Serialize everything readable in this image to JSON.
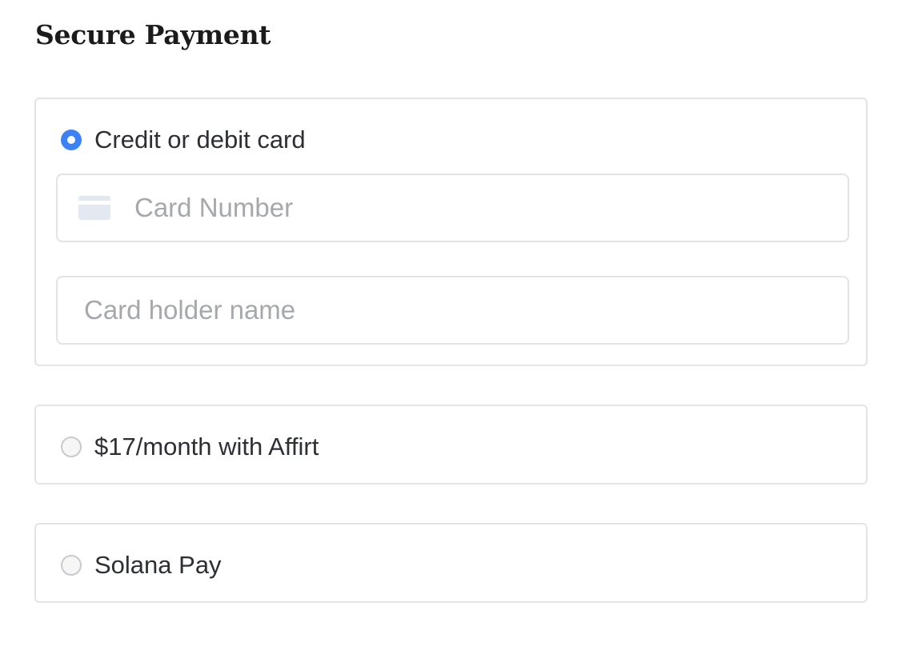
{
  "page": {
    "title": "Secure Payment"
  },
  "payment_options": {
    "card": {
      "label": "Credit or debit card",
      "selected": true,
      "card_number": {
        "placeholder": "Card Number",
        "value": "",
        "icon": "credit-card-icon"
      },
      "holder_name": {
        "placeholder": "Card holder name",
        "value": ""
      }
    },
    "affirm": {
      "label": "$17/month with Affirt",
      "selected": false
    },
    "solana": {
      "label": "Solana Pay",
      "selected": false
    }
  },
  "colors": {
    "accent": "#3b82f6",
    "border": "#e3e4e6",
    "placeholder": "#a7a8ab",
    "icon": "#e3e8f1"
  }
}
